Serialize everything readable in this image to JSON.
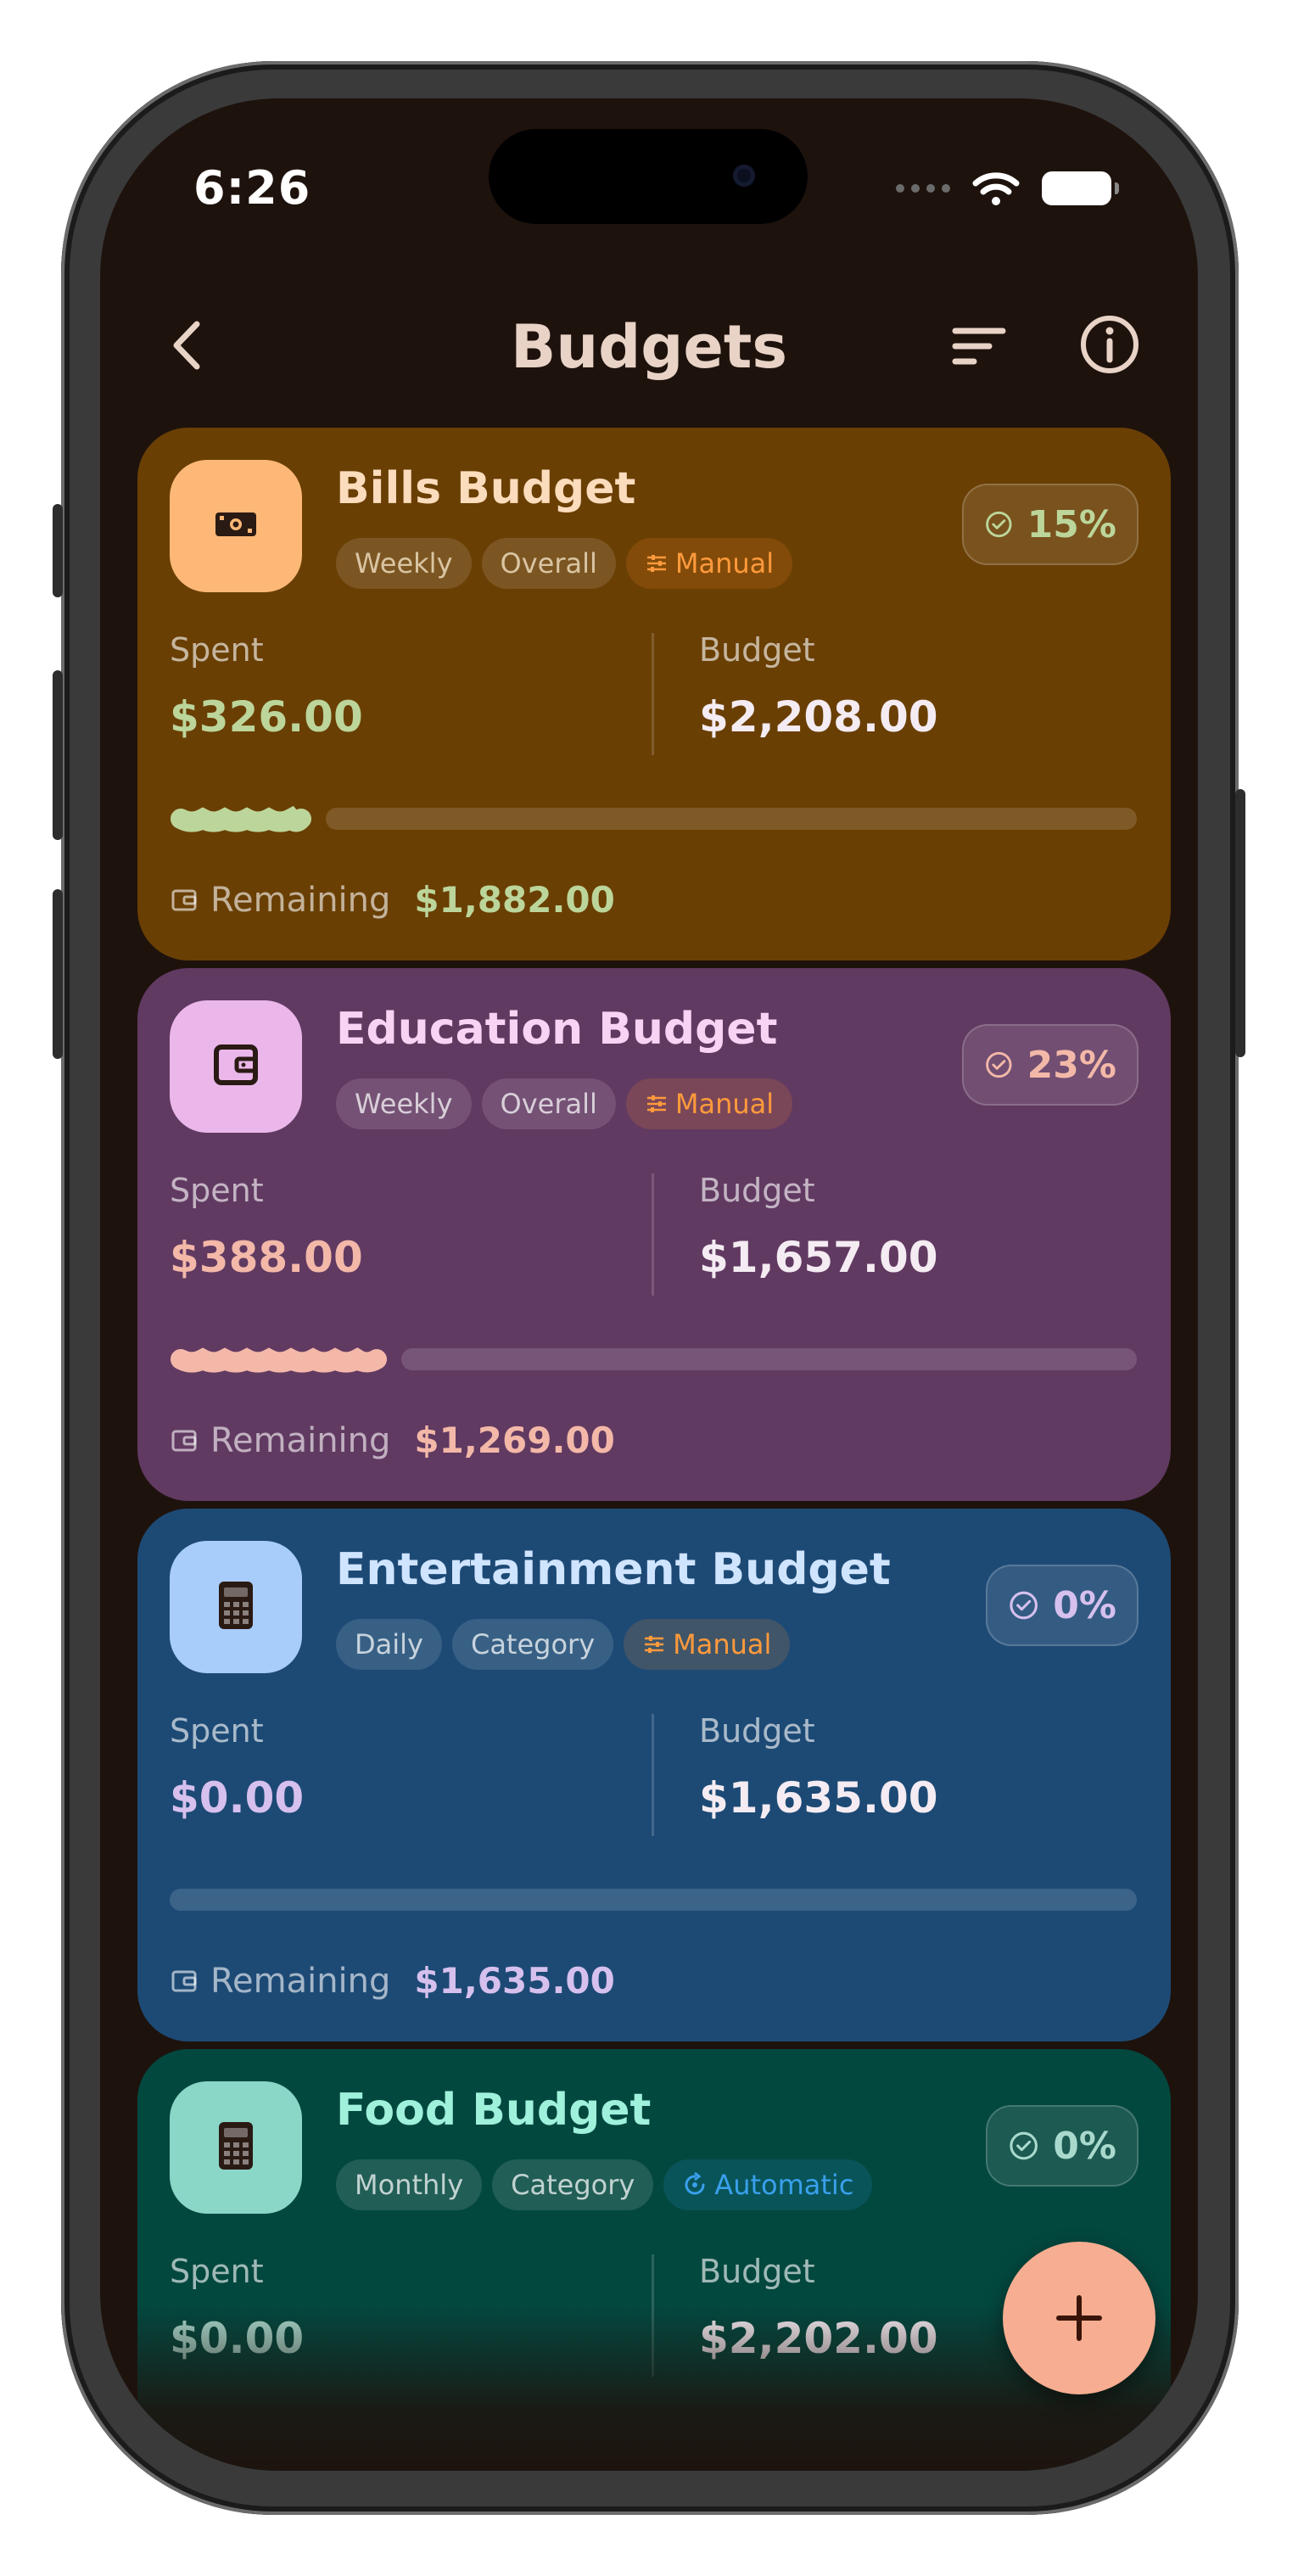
{
  "status_bar": {
    "time": "6:26"
  },
  "header": {
    "title": "Budgets"
  },
  "budgets": [
    {
      "name": "Bills Budget",
      "icon": "banknote-icon",
      "tags": [
        "Weekly",
        "Overall",
        "Manual"
      ],
      "percent": "15%",
      "spent_label": "Spent",
      "spent": "$326.00",
      "budget_label": "Budget",
      "budget": "$2,208.00",
      "progress": 0.15,
      "remaining_label": "Remaining",
      "remaining": "$1,882.00",
      "colors": {
        "card": "#6a3f04",
        "accent": "#bcd59a",
        "title": "#fbdcbc",
        "icon_bg": "#fdb877"
      }
    },
    {
      "name": "Education Budget",
      "icon": "wallet-icon",
      "tags": [
        "Weekly",
        "Overall",
        "Manual"
      ],
      "percent": "23%",
      "spent_label": "Spent",
      "spent": "$388.00",
      "budget_label": "Budget",
      "budget": "$1,657.00",
      "progress": 0.23,
      "remaining_label": "Remaining",
      "remaining": "$1,269.00",
      "colors": {
        "card": "#613a62",
        "accent": "#f3b8a8",
        "title": "#f9d3f4",
        "icon_bg": "#ebb7ea"
      }
    },
    {
      "name": "Entertainment Budget",
      "icon": "calculator-icon",
      "tags": [
        "Daily",
        "Category",
        "Manual"
      ],
      "percent": "0%",
      "spent_label": "Spent",
      "spent": "$0.00",
      "budget_label": "Budget",
      "budget": "$1,635.00",
      "progress": 0,
      "remaining_label": "Remaining",
      "remaining": "$1,635.00",
      "colors": {
        "card": "#1d4a75",
        "accent": "#d6c0ee",
        "title": "#cfe4ff",
        "icon_bg": "#a9cdfb"
      }
    },
    {
      "name": "Food Budget",
      "icon": "calculator-icon",
      "tags": [
        "Monthly",
        "Category",
        "Automatic"
      ],
      "percent": "0%",
      "spent_label": "Spent",
      "spent": "$0.00",
      "budget_label": "Budget",
      "budget": "$2,202.00",
      "colors": {
        "card": "#03483f",
        "accent": "#a9d9cd",
        "title": "#9ff1dc",
        "icon_bg": "#8ad6c7"
      }
    }
  ],
  "fab": {
    "icon": "plus-icon"
  }
}
